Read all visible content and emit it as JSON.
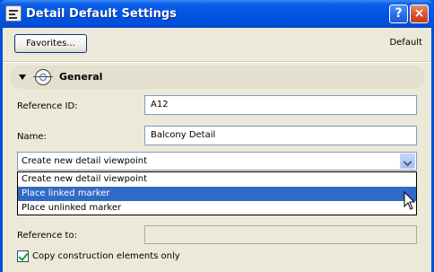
{
  "window": {
    "title": "Detail Default Settings",
    "help_label": "?",
    "close_label": "×"
  },
  "toolbar": {
    "favorites_label": "Favorites...",
    "default_label": "Default"
  },
  "section": {
    "title": "General"
  },
  "fields": {
    "reference_id": {
      "label": "Reference ID:",
      "value": "A12"
    },
    "name": {
      "label": "Name:",
      "value": "Balcony Detail"
    },
    "reference_to": {
      "label": "Reference to:",
      "value": ""
    }
  },
  "viewpoint_select": {
    "value": "Create new detail viewpoint",
    "options": [
      "Create new detail viewpoint",
      "Place linked marker",
      "Place unlinked marker"
    ],
    "highlighted_index": 1
  },
  "copy_checkbox": {
    "label": "Copy construction elements only",
    "checked": true
  },
  "colors": {
    "titlebar": "#0153e3",
    "client_bg": "#ece9d8",
    "selection": "#316ac5",
    "close_button": "#d5532d"
  }
}
